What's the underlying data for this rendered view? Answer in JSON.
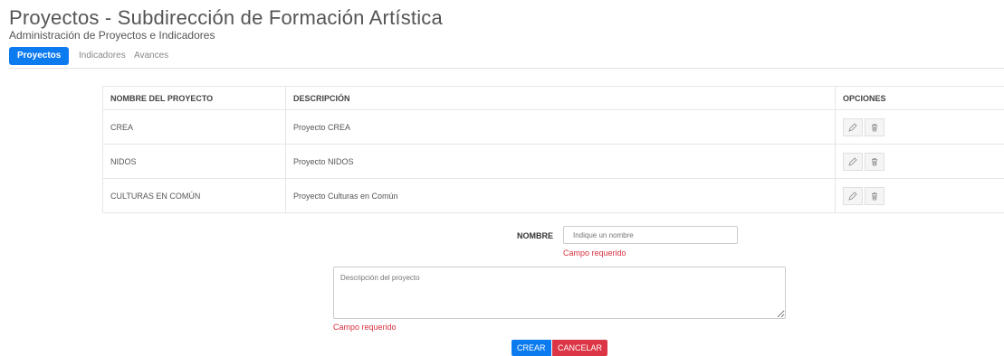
{
  "header": {
    "title": "Proyectos - Subdirección de Formación Artística",
    "subtitle": "Administración de Proyectos e Indicadores"
  },
  "tabs": [
    {
      "label": "Proyectos",
      "active": true
    },
    {
      "label": "Indicadores",
      "active": false
    },
    {
      "label": "Avances",
      "active": false
    }
  ],
  "table": {
    "columns": [
      "NOMBRE DEL PROYECTO",
      "DESCRIPCIÓN",
      "OPCIONES"
    ],
    "rows": [
      {
        "name": "CREA",
        "description": "Proyecto CREA"
      },
      {
        "name": "NIDOS",
        "description": "Proyecto NIDOS"
      },
      {
        "name": "CULTURAS EN COMÚN",
        "description": "Proyecto Culturas en Común"
      }
    ],
    "row_icons": [
      "pencil-icon",
      "trash-icon"
    ]
  },
  "form": {
    "name_label": "NOMBRE",
    "name_placeholder": "Indique un nombre",
    "name_error": "Campo requerido",
    "description_placeholder": "Descripción del proyecto",
    "description_error": "Campo requerido",
    "create_label": "CREAR",
    "cancel_label": "CANCELAR"
  },
  "colors": {
    "primary": "#0d7bf0",
    "danger": "#dc3545",
    "error_text": "#d9303e"
  }
}
